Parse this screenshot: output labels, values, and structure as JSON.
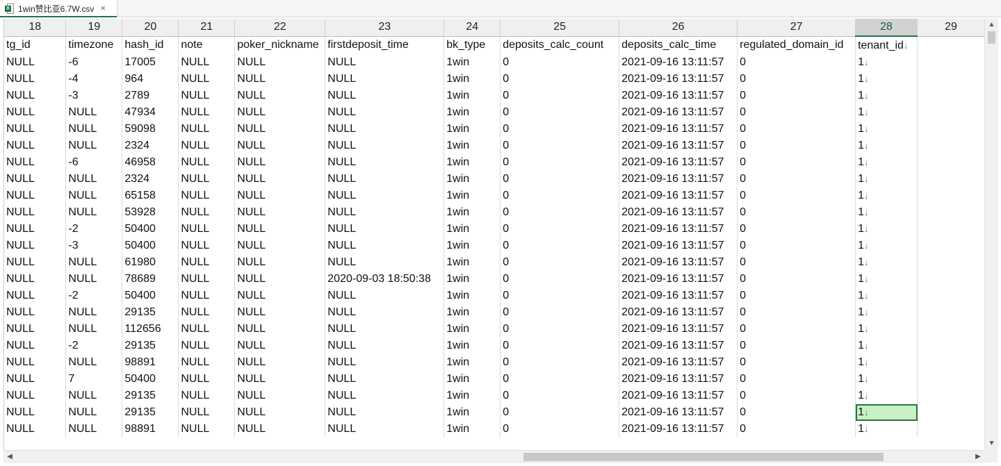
{
  "tab": {
    "title": "1win赞比亚6.7W.csv",
    "close": "×"
  },
  "columns": [
    "18",
    "19",
    "20",
    "21",
    "22",
    "23",
    "24",
    "25",
    "26",
    "27",
    "28",
    "29"
  ],
  "header_row": [
    "tg_id",
    "timezone",
    "hash_id",
    "note",
    "poker_nickname",
    "firstdeposit_time",
    "bk_type",
    "deposits_calc_count",
    "deposits_calc_time",
    "regulated_domain_id",
    "tenant_id",
    ""
  ],
  "rows": [
    [
      "NULL",
      "-6",
      "17005",
      "NULL",
      "NULL",
      "NULL",
      "1win",
      "0",
      "2021-09-16 13:11:57",
      "0",
      "1",
      ""
    ],
    [
      "NULL",
      "-4",
      "964",
      "NULL",
      "NULL",
      "NULL",
      "1win",
      "0",
      "2021-09-16 13:11:57",
      "0",
      "1",
      ""
    ],
    [
      "NULL",
      "-3",
      "2789",
      "NULL",
      "NULL",
      "NULL",
      "1win",
      "0",
      "2021-09-16 13:11:57",
      "0",
      "1",
      ""
    ],
    [
      "NULL",
      "NULL",
      "47934",
      "NULL",
      "NULL",
      "NULL",
      "1win",
      "0",
      "2021-09-16 13:11:57",
      "0",
      "1",
      ""
    ],
    [
      "NULL",
      "NULL",
      "59098",
      "NULL",
      "NULL",
      "NULL",
      "1win",
      "0",
      "2021-09-16 13:11:57",
      "0",
      "1",
      ""
    ],
    [
      "NULL",
      "NULL",
      "2324",
      "NULL",
      "NULL",
      "NULL",
      "1win",
      "0",
      "2021-09-16 13:11:57",
      "0",
      "1",
      ""
    ],
    [
      "NULL",
      "-6",
      "46958",
      "NULL",
      "NULL",
      "NULL",
      "1win",
      "0",
      "2021-09-16 13:11:57",
      "0",
      "1",
      ""
    ],
    [
      "NULL",
      "NULL",
      "2324",
      "NULL",
      "NULL",
      "NULL",
      "1win",
      "0",
      "2021-09-16 13:11:57",
      "0",
      "1",
      ""
    ],
    [
      "NULL",
      "NULL",
      "65158",
      "NULL",
      "NULL",
      "NULL",
      "1win",
      "0",
      "2021-09-16 13:11:57",
      "0",
      "1",
      ""
    ],
    [
      "NULL",
      "NULL",
      "53928",
      "NULL",
      "NULL",
      "NULL",
      "1win",
      "0",
      "2021-09-16 13:11:57",
      "0",
      "1",
      ""
    ],
    [
      "NULL",
      "-2",
      "50400",
      "NULL",
      "NULL",
      "NULL",
      "1win",
      "0",
      "2021-09-16 13:11:57",
      "0",
      "1",
      ""
    ],
    [
      "NULL",
      "-3",
      "50400",
      "NULL",
      "NULL",
      "NULL",
      "1win",
      "0",
      "2021-09-16 13:11:57",
      "0",
      "1",
      ""
    ],
    [
      "NULL",
      "NULL",
      "61980",
      "NULL",
      "NULL",
      "NULL",
      "1win",
      "0",
      "2021-09-16 13:11:57",
      "0",
      "1",
      ""
    ],
    [
      "NULL",
      "NULL",
      "78689",
      "NULL",
      "NULL",
      "2020-09-03 18:50:38",
      "1win",
      "0",
      "2021-09-16 13:11:57",
      "0",
      "1",
      ""
    ],
    [
      "NULL",
      "-2",
      "50400",
      "NULL",
      "NULL",
      "NULL",
      "1win",
      "0",
      "2021-09-16 13:11:57",
      "0",
      "1",
      ""
    ],
    [
      "NULL",
      "NULL",
      "29135",
      "NULL",
      "NULL",
      "NULL",
      "1win",
      "0",
      "2021-09-16 13:11:57",
      "0",
      "1",
      ""
    ],
    [
      "NULL",
      "NULL",
      "112656",
      "NULL",
      "NULL",
      "NULL",
      "1win",
      "0",
      "2021-09-16 13:11:57",
      "0",
      "1",
      ""
    ],
    [
      "NULL",
      "-2",
      "29135",
      "NULL",
      "NULL",
      "NULL",
      "1win",
      "0",
      "2021-09-16 13:11:57",
      "0",
      "1",
      ""
    ],
    [
      "NULL",
      "NULL",
      "98891",
      "NULL",
      "NULL",
      "NULL",
      "1win",
      "0",
      "2021-09-16 13:11:57",
      "0",
      "1",
      ""
    ],
    [
      "NULL",
      "7",
      "50400",
      "NULL",
      "NULL",
      "NULL",
      "1win",
      "0",
      "2021-09-16 13:11:57",
      "0",
      "1",
      ""
    ],
    [
      "NULL",
      "NULL",
      "29135",
      "NULL",
      "NULL",
      "NULL",
      "1win",
      "0",
      "2021-09-16 13:11:57",
      "0",
      "1",
      ""
    ],
    [
      "NULL",
      "NULL",
      "29135",
      "NULL",
      "NULL",
      "NULL",
      "1win",
      "0",
      "2021-09-16 13:11:57",
      "0",
      "1",
      ""
    ],
    [
      "NULL",
      "NULL",
      "98891",
      "NULL",
      "NULL",
      "NULL",
      "1win",
      "0",
      "2021-09-16 13:11:57",
      "0",
      "1",
      ""
    ]
  ],
  "arrow_glyph": "↓",
  "selected": {
    "row": 21,
    "col": 10
  },
  "active_column": 10,
  "colors": {
    "accent": "#217346",
    "selection_fill": "#c9f0c5",
    "arrow": "#3a86d0"
  }
}
